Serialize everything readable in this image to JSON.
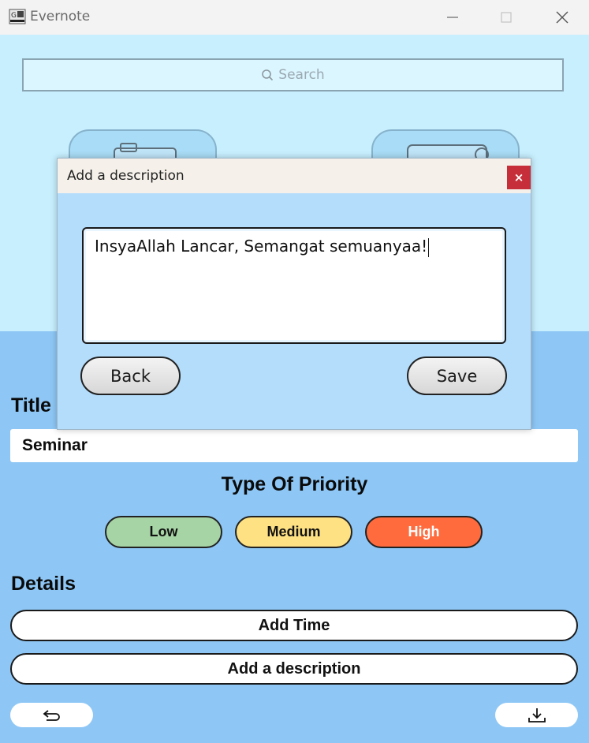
{
  "window": {
    "title": "Evernote"
  },
  "search": {
    "placeholder": "Search"
  },
  "form": {
    "title_label": "Title",
    "title_value": "Seminar",
    "priority_label": "Type Of Priority",
    "priorities": [
      {
        "label": "Low",
        "color": "#a7d4a5"
      },
      {
        "label": "Medium",
        "color": "#fee182"
      },
      {
        "label": "High",
        "color": "#ff6b3d"
      }
    ],
    "details_label": "Details",
    "add_time_label": "Add Time",
    "add_description_label": "Add a description"
  },
  "dialog": {
    "title": "Add a description",
    "close_label": "×",
    "text": "InsyaAllah Lancar, Semangat semuanyaa!",
    "back_label": "Back",
    "save_label": "Save"
  },
  "icons": {
    "back": "back-arrow-icon",
    "download": "download-icon",
    "search": "search-icon"
  }
}
